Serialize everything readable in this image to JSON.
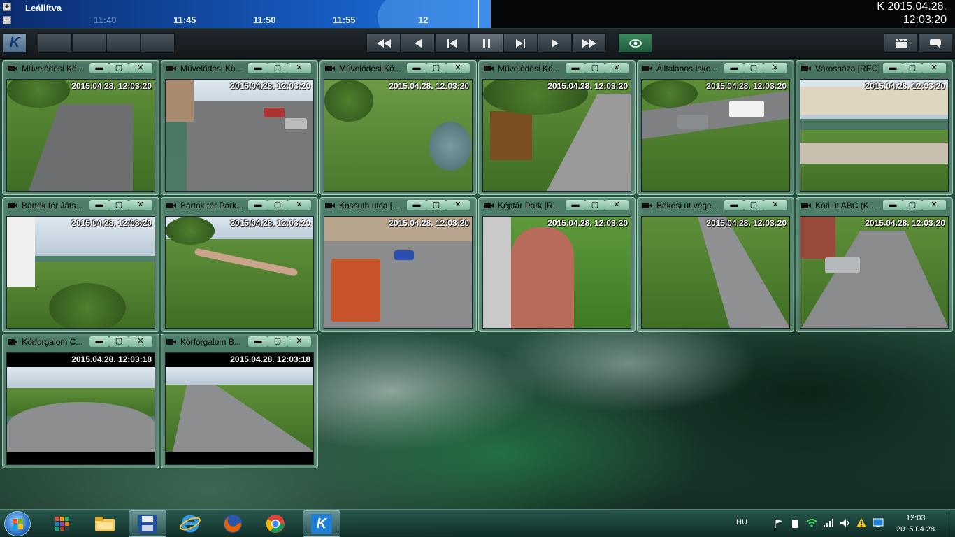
{
  "top_bar": {
    "plus_label": "+",
    "minus_label": "−",
    "status": "Leállítva",
    "ticks": [
      "11:40",
      "11:45",
      "11:50",
      "11:55",
      "12"
    ],
    "clock_date": "K 2015.04.28.",
    "clock_time": "12:03:20"
  },
  "toolbar": {
    "logo_label": "K",
    "icons": {
      "rewind_fast": "fast-rewind-icon",
      "step_back": "step-back-icon",
      "skip_start": "skip-start-icon",
      "pause": "pause-icon",
      "skip_end": "skip-end-icon",
      "play": "play-icon",
      "fast_forward": "fast-forward-icon",
      "eye": "eye-icon",
      "clapper": "clapperboard-icon",
      "chat": "speech-bubble-icon"
    }
  },
  "cameras": [
    {
      "name": "Művelődési Kö...",
      "time": "2015.04.28. 12:03:20"
    },
    {
      "name": "Művelődési Kö...",
      "time": "2015.04.28. 12:03:20"
    },
    {
      "name": "Művelődési Kö...",
      "time": "2015.04.28. 12:03:20"
    },
    {
      "name": "Művelődési Kö...",
      "time": "2015.04.28. 12:03:20"
    },
    {
      "name": "Álltalános Isko...",
      "time": "2015.04.28. 12:03:20"
    },
    {
      "name": "Városháza [REC]",
      "time": "2015.04.28. 12:03:20"
    },
    {
      "name": "Bartók tér Játs...",
      "time": "2015.04.28. 12:03:20"
    },
    {
      "name": "Bartók tér Park...",
      "time": "2015.04.28. 12:03:20"
    },
    {
      "name": "Kossuth utca [...",
      "time": "2015.04.28. 12:03:20"
    },
    {
      "name": "Képtár Park [R...",
      "time": "2015.04.28. 12:03:20"
    },
    {
      "name": "Békési út vége...",
      "time": "2015.04.28. 12:03:20"
    },
    {
      "name": "Kóti út ABC (K...",
      "time": "2015.04.28. 12:03:20"
    },
    {
      "name": "Körforgalom C...",
      "time": "2015.04.28. 12:03:18"
    },
    {
      "name": "Körforgalom B...",
      "time": "2015.04.28. 12:03:18"
    }
  ],
  "window_controls": {
    "minimize": "▬",
    "maximize": "▢",
    "close": "✕"
  },
  "taskbar": {
    "apps": [
      {
        "icon": "metro-tiles-icon"
      },
      {
        "icon": "file-explorer-icon"
      },
      {
        "icon": "save-disk-icon"
      },
      {
        "icon": "internet-explorer-icon"
      },
      {
        "icon": "firefox-icon"
      },
      {
        "icon": "chrome-icon"
      },
      {
        "icon": "k-app-icon",
        "label": "K"
      }
    ],
    "language": "HU",
    "time": "12:03",
    "date": "2015.04.28."
  }
}
